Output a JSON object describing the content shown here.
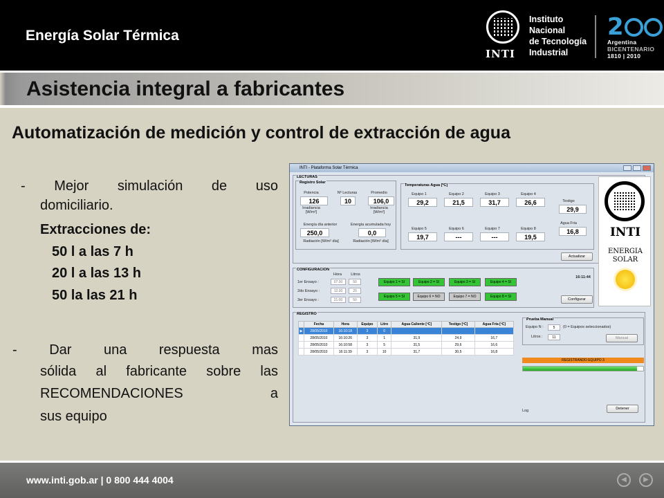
{
  "header": {
    "title": "Energía Solar Térmica",
    "inti_logo_text": "INTI",
    "institution_lines": [
      "Instituto",
      "Nacional",
      "de Tecnología",
      "Industrial"
    ],
    "bicentenario": {
      "number": "200",
      "lines": [
        "Argentina",
        "BICENTENARIO",
        "1810 | 2010"
      ]
    }
  },
  "subtitle": "Asistencia integral a fabricantes",
  "heading": "Automatización de medición y control de extracción de agua",
  "content": {
    "bullet1_line1": "- Mejor simulación de uso",
    "bullet1_line2": "domiciliario.",
    "extracciones_label": "Extracciones de:",
    "extracciones": [
      "50 l a las 7 h",
      "20 l a las 13 h",
      "50 la las 21 h"
    ],
    "bullet2_lines": [
      "-   Dar una respuesta mas",
      "sólida al fabricante sobre las",
      "RECOMENDACIONES a",
      "sus equipo"
    ]
  },
  "footer": {
    "url": "www.inti.gob.ar | 0 800 444 4004",
    "prev_icon": "chevron-left-icon",
    "next_icon": "chevron-right-icon"
  },
  "app": {
    "window_title": "INTI - Plataforma Solar Térmica",
    "lecturas_label": "LECTURAS",
    "registro_solar": {
      "label": "Registro Solar",
      "potencia_label": "Potencia",
      "potencia": "126",
      "nlecturas_label": "Nº Lecturas",
      "nlecturas": "10",
      "promedio_label": "Promedio",
      "promedio": "106,0",
      "irradiancia_label": "Irradiancia [W/m²]",
      "irradiancia2_label": "Irradiancia [W/m²]",
      "energia_label": "Energía día anterior",
      "energia": "250,0",
      "energia_acum_label": "Energía acumulada hoy",
      "energia_acum": "0,0",
      "radiacion_label": "Radiación [W/m² día]",
      "radiacion2_label": "Radiación [W/m² día]"
    },
    "temperaturas": {
      "label": "Temperaturas Agua [ºC]",
      "equipos": [
        {
          "name": "Equipo 1",
          "value": "29,2"
        },
        {
          "name": "Equipo 2",
          "value": "21,5"
        },
        {
          "name": "Equipo 3",
          "value": "31,7"
        },
        {
          "name": "Equipo 4",
          "value": "26,6"
        },
        {
          "name": "Equipo 5",
          "value": "19,7"
        },
        {
          "name": "Equipo 6",
          "value": "---"
        },
        {
          "name": "Equipo 7",
          "value": "---"
        },
        {
          "name": "Equipo 8",
          "value": "19,5"
        }
      ],
      "testigo_label": "Testigo",
      "testigo": "29,9",
      "agua_fria_label": "Agua Fria",
      "agua_fria": "16,8",
      "actualizar": "Actualizar"
    },
    "configuracion": {
      "label": "CONFIGURACION",
      "hora_label": "Hora",
      "litros_label": "Litros",
      "ensayos": [
        {
          "label": "1er Ensayo :",
          "hora": "07:30",
          "litros": "50"
        },
        {
          "label": "2do Ensayo :",
          "hora": "12:30",
          "litros": "20"
        },
        {
          "label": "3er Ensayo :",
          "hora": "21:00",
          "litros": "50"
        }
      ],
      "equipos_btns": [
        {
          "label": "Equipo 1 = SI",
          "on": true
        },
        {
          "label": "Equipo 2 = SI",
          "on": true
        },
        {
          "label": "Equipo 3 = SI",
          "on": true
        },
        {
          "label": "Equipo 4 = SI",
          "on": true
        },
        {
          "label": "Equipo 5 = SI",
          "on": true
        },
        {
          "label": "Equipo 6 = NO",
          "on": false
        },
        {
          "label": "Equipo 7 = NO",
          "on": false
        },
        {
          "label": "Equipo 8 = SI",
          "on": true
        }
      ],
      "time": "16:11:44",
      "configurar": "Configurar"
    },
    "registro": {
      "label": "REGISTRO",
      "columns": [
        "",
        "Fecha",
        "Hora",
        "Equipo",
        "Litro",
        "Agua Caliente  [ºC]",
        "Testigo [ºC]",
        "Agua Fría [ºC]"
      ],
      "rows": [
        [
          "▶",
          "28/05/2010",
          "16:10:18",
          "3",
          "0",
          "",
          "",
          ""
        ],
        [
          "",
          "28/05/2010",
          "16:10:26",
          "3",
          "1",
          "31,9",
          "24,9",
          "16,7"
        ],
        [
          "",
          "28/05/2010",
          "16:10:58",
          "3",
          "5",
          "31,5",
          "29,6",
          "16,6"
        ],
        [
          "",
          "28/05/2010",
          "16:11:39",
          "3",
          "10",
          "31,7",
          "30,5",
          "16,8"
        ]
      ],
      "prueba_label": "Prueba Manual",
      "equipo_n_label": "Equipo N :",
      "equipo_n": "5",
      "equipo_hint": "(0 = Equipos seleccionados)",
      "litros_label": "Litros :",
      "litros": "11",
      "manual": "Manual",
      "status": "REGISTRANDO EQUIPO 3",
      "progress": 0.95,
      "log_label": "Log",
      "detener": "Detener"
    },
    "side_logo": {
      "inti": "INTI",
      "line1": "ENERGIA",
      "line2": "SOLAR"
    }
  }
}
